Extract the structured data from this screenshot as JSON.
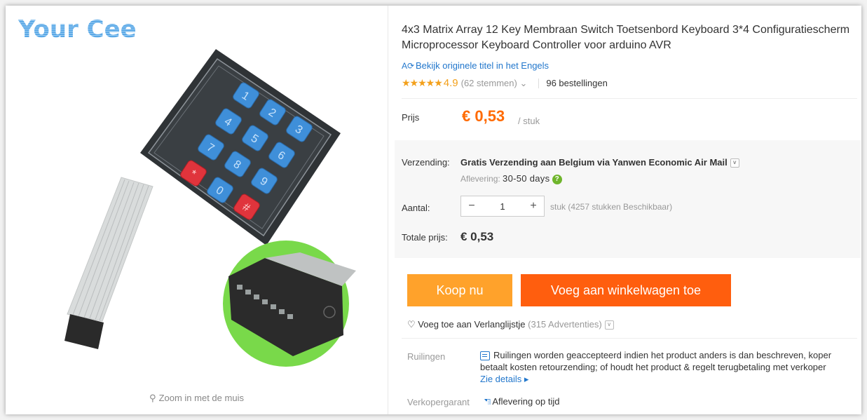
{
  "watermark": "Your Cee",
  "zoom_hint": "Zoom in met de muis",
  "product": {
    "title": "4x3 Matrix Array 12 Key Membraan Switch Toetsenbord Keyboard 3*4 Configuratiescherm Microprocessor Keyboard Controller voor arduino AVR",
    "original_title_link": "Bekijk originele titel in het Engels",
    "stars": "★★★★★",
    "rating": "4.9",
    "votes": "(62 stemmen)",
    "votes_chevron": "⌄",
    "orders": "96 bestellingen"
  },
  "price": {
    "label": "Prijs",
    "value": "€ 0,53",
    "unit": "/ stuk"
  },
  "shipping": {
    "label": "Verzending:",
    "method": "Gratis Verzending aan Belgium via Yanwen Economic Air Mail",
    "delivery_label": "Aflevering:",
    "delivery_days": "30-50 days",
    "help": "?"
  },
  "quantity": {
    "label": "Aantal:",
    "minus": "−",
    "value": "1",
    "plus": "+",
    "stock": "stuk (4257 stukken Beschikbaar)"
  },
  "total": {
    "label": "Totale prijs:",
    "value": "€ 0,53"
  },
  "buttons": {
    "buy_now": "Koop nu",
    "add_to_cart": "Voeg aan winkelwagen toe"
  },
  "wishlist": {
    "label": "Voeg toe aan Verlanglijstje",
    "count": "(315 Advertenties)"
  },
  "returns": {
    "label": "Ruilingen",
    "text": "Ruilingen worden geaccepteerd indien het product anders is dan beschreven, koper betaalt kosten retourzending; of houdt het product & regelt terugbetaling met verkoper",
    "details_link": "Zie details ▸"
  },
  "guarantee": {
    "label": "Verkopergarant",
    "text": "Aflevering op tijd"
  },
  "keypad": {
    "keys": [
      "1",
      "2",
      "3",
      "4",
      "5",
      "6",
      "7",
      "8",
      "9",
      "*",
      "0",
      "#"
    ]
  },
  "colors": {
    "accent_orange": "#ff6a00",
    "buy_button": "#ffa22b",
    "cart_button": "#ff5e0e",
    "link_blue": "#2277cc",
    "star": "#f3a01b"
  }
}
